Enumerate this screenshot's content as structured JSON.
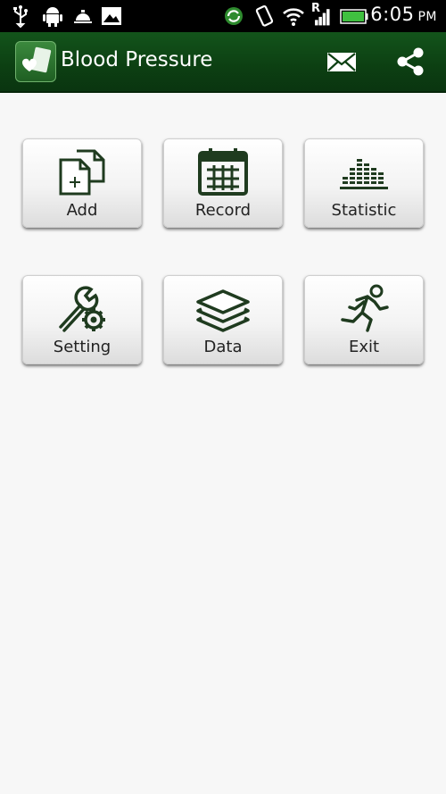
{
  "status_bar": {
    "time": "6:05",
    "ampm": "PM",
    "icons": [
      "usb-icon",
      "android-debug-icon",
      "bell-icon",
      "image-icon",
      "sync-icon",
      "vibrate-icon",
      "wifi-icon",
      "roaming-signal-icon",
      "battery-icon"
    ],
    "roaming_label": "R"
  },
  "action_bar": {
    "title": "Blood Pressure",
    "actions": [
      "mail-icon",
      "share-icon"
    ]
  },
  "menu": {
    "items": [
      {
        "label": "Add",
        "icon": "add-document-icon"
      },
      {
        "label": "Record",
        "icon": "calendar-icon"
      },
      {
        "label": "Statistic",
        "icon": "statistic-bars-icon"
      },
      {
        "label": "Setting",
        "icon": "settings-wrench-gear-icon"
      },
      {
        "label": "Data",
        "icon": "layers-icon"
      },
      {
        "label": "Exit",
        "icon": "running-man-icon"
      }
    ]
  },
  "colors": {
    "action_bar": "#0c3f12",
    "icon_green": "#1f3b1f",
    "background": "#f7f7f7"
  }
}
